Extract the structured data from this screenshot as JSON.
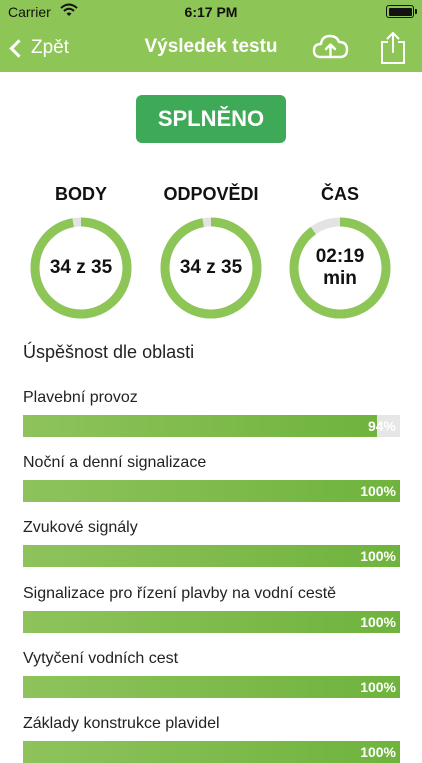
{
  "status_bar": {
    "carrier": "Carrier",
    "time": "6:17 PM"
  },
  "nav": {
    "back_label": "Zpět",
    "title": "Výsledek testu",
    "icons": [
      "cloud-upload-icon",
      "share-icon"
    ]
  },
  "result": {
    "badge": "SPLNĚNO"
  },
  "stats": [
    {
      "label": "BODY",
      "value": "34 z 35",
      "progress": 0.971
    },
    {
      "label": "ODPOVĚDI",
      "value": "34 z 35",
      "progress": 0.971
    },
    {
      "label": "ČAS",
      "value": "02:19\nmin",
      "progress": 0.9
    }
  ],
  "section_title": "Úspěšnost dle oblasti",
  "areas": [
    {
      "label": "Plavební provoz",
      "percent": 94,
      "percent_text": "94%"
    },
    {
      "label": "Noční a denní signalizace",
      "percent": 100,
      "percent_text": "100%"
    },
    {
      "label": "Zvukové signály",
      "percent": 100,
      "percent_text": "100%"
    },
    {
      "label": "Signalizace pro řízení plavby na vodní cestě",
      "percent": 100,
      "percent_text": "100%"
    },
    {
      "label": "Vytyčení vodních cest",
      "percent": 100,
      "percent_text": "100%"
    },
    {
      "label": "Základy konstrukce plavidel",
      "percent": 100,
      "percent_text": "100%"
    }
  ],
  "colors": {
    "header": "#8dc556",
    "badge": "#3ea956",
    "ring": "#8dc556",
    "ring_track": "#e3e3e3",
    "bar_track": "#e6e6e6"
  }
}
